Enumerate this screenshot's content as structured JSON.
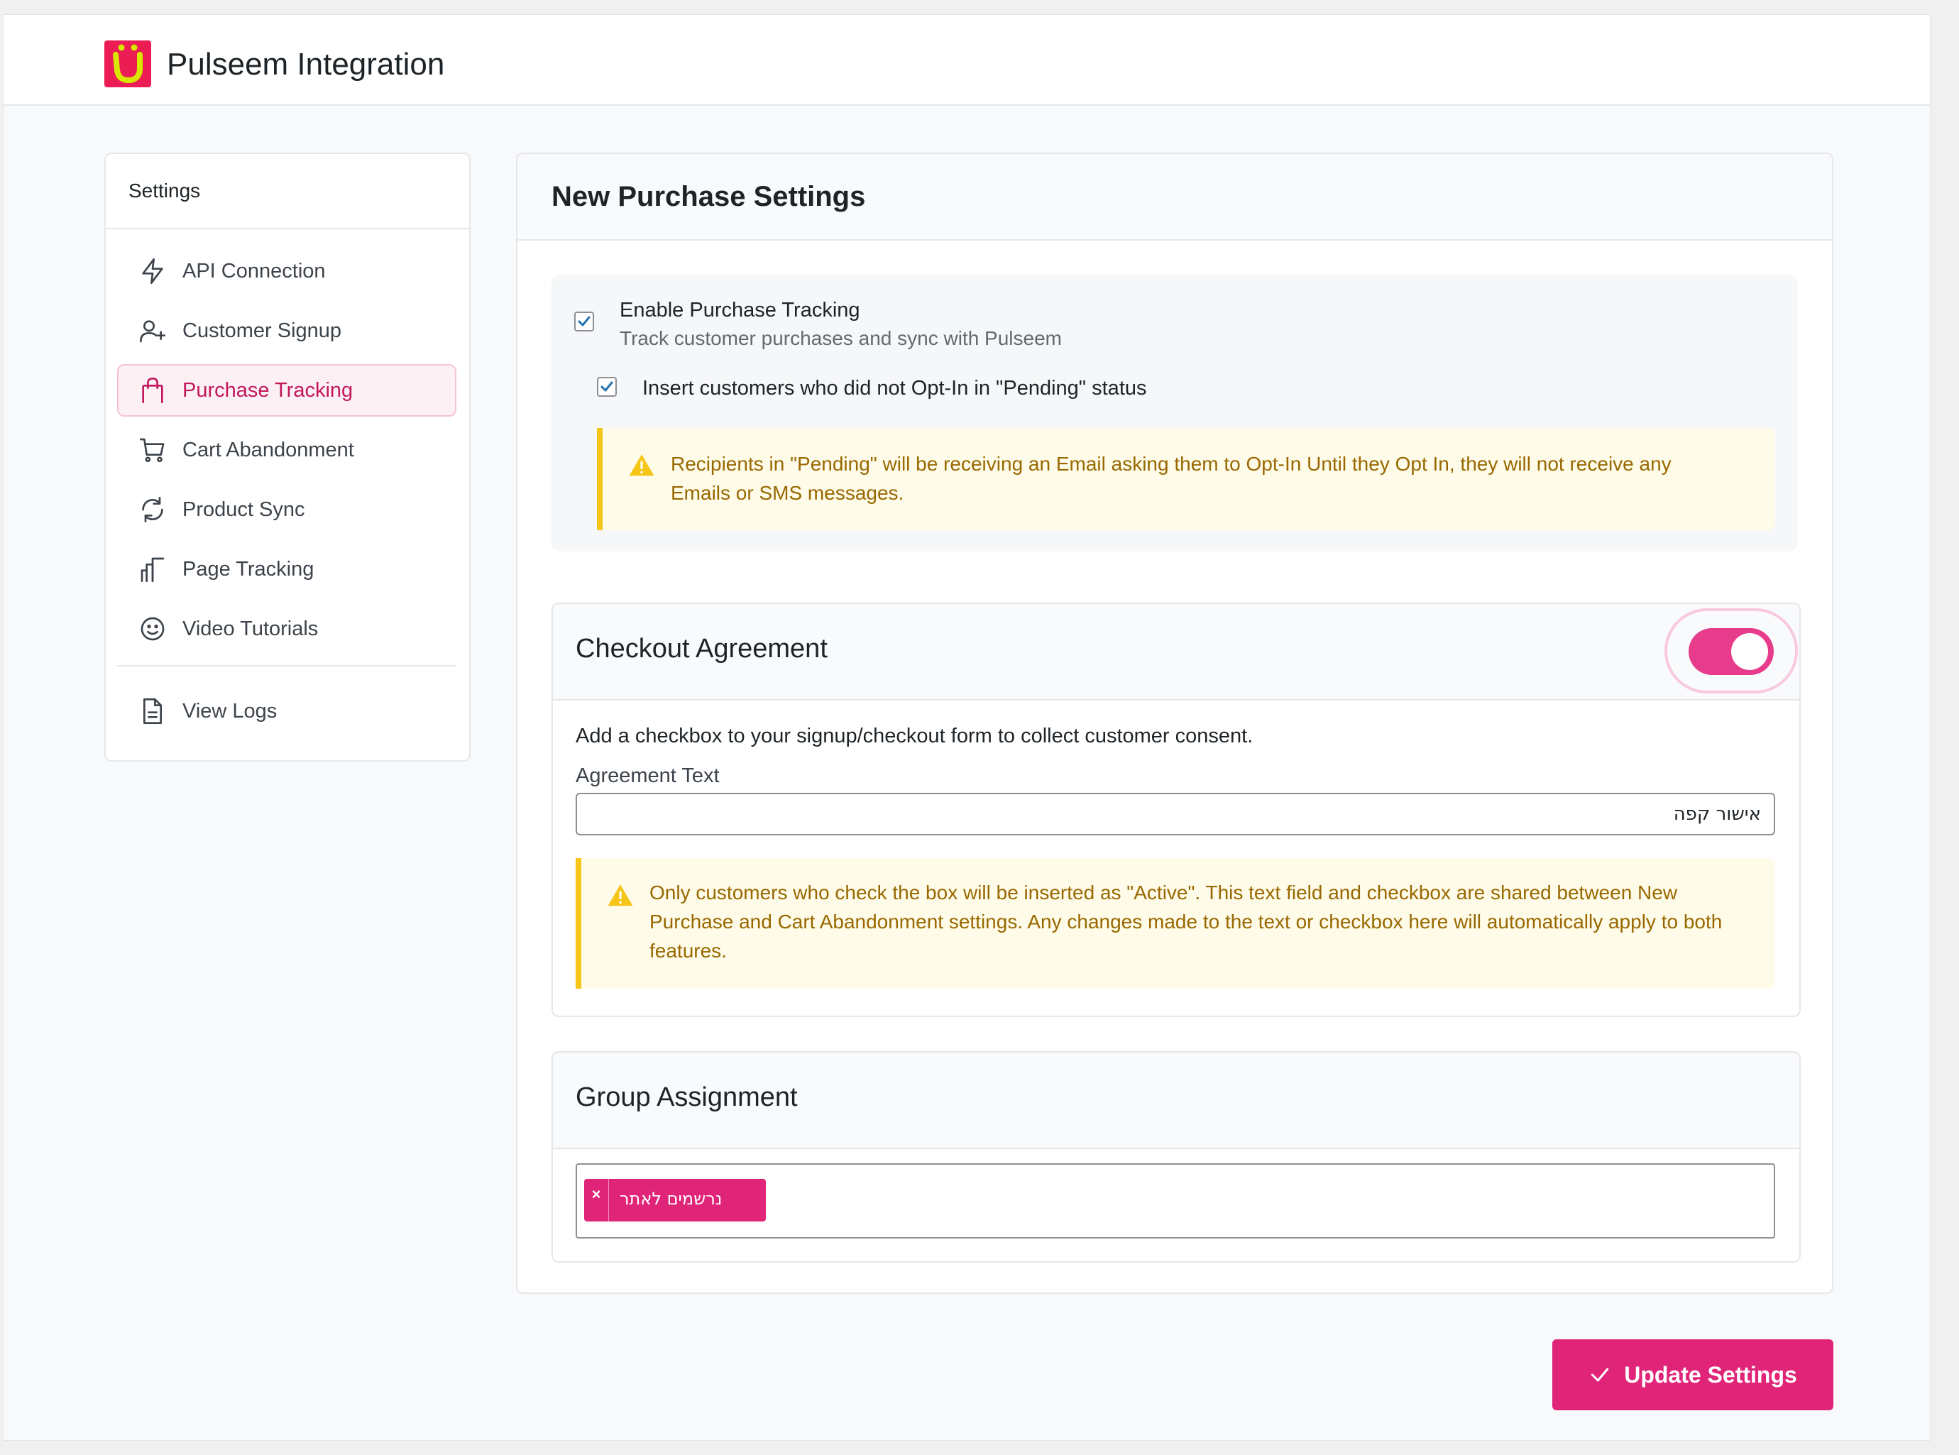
{
  "app": {
    "title": "Pulseem Integration"
  },
  "colors": {
    "accent": "#e02579",
    "warning": "#f5c518",
    "warning_text": "#996800"
  },
  "sidebar": {
    "heading": "Settings",
    "items": [
      {
        "label": "API Connection",
        "icon": "lightning-icon",
        "active": false
      },
      {
        "label": "Customer Signup",
        "icon": "user-plus-icon",
        "active": false
      },
      {
        "label": "Purchase Tracking",
        "icon": "shopping-bag-icon",
        "active": true
      },
      {
        "label": "Cart Abandonment",
        "icon": "cart-icon",
        "active": false
      },
      {
        "label": "Product Sync",
        "icon": "sync-icon",
        "active": false
      },
      {
        "label": "Page Tracking",
        "icon": "chart-icon",
        "active": false
      },
      {
        "label": "Video Tutorials",
        "icon": "smiley-icon",
        "active": false
      },
      {
        "label": "View Logs",
        "icon": "document-icon",
        "active": false
      }
    ]
  },
  "main": {
    "title": "New Purchase Settings",
    "purchase_tracking": {
      "enabled": true,
      "label": "Enable Purchase Tracking",
      "description": "Track customer purchases and sync with Pulseem",
      "pending": {
        "checked": true,
        "label": "Insert customers who did not Opt-In in \"Pending\" status"
      },
      "notice": "Recipients in \"Pending\" will be receiving an Email asking them to Opt-In Until they Opt In, they will not receive any Emails or SMS messages."
    },
    "checkout_agreement": {
      "title": "Checkout Agreement",
      "enabled": true,
      "description": "Add a checkbox to your signup/checkout form to collect customer consent.",
      "field_label": "Agreement Text",
      "field_value": "אישור קפה",
      "notice": "Only customers who check the box will be inserted as \"Active\". This text field and checkbox are shared between New Purchase and Cart Abandonment settings. Any changes made to the text or checkbox here will automatically apply to both features."
    },
    "group_assignment": {
      "title": "Group Assignment",
      "selected_tags": [
        {
          "label": "נרשמים לאתר",
          "remove": "×"
        }
      ]
    }
  },
  "footer": {
    "update_label": "Update Settings"
  }
}
